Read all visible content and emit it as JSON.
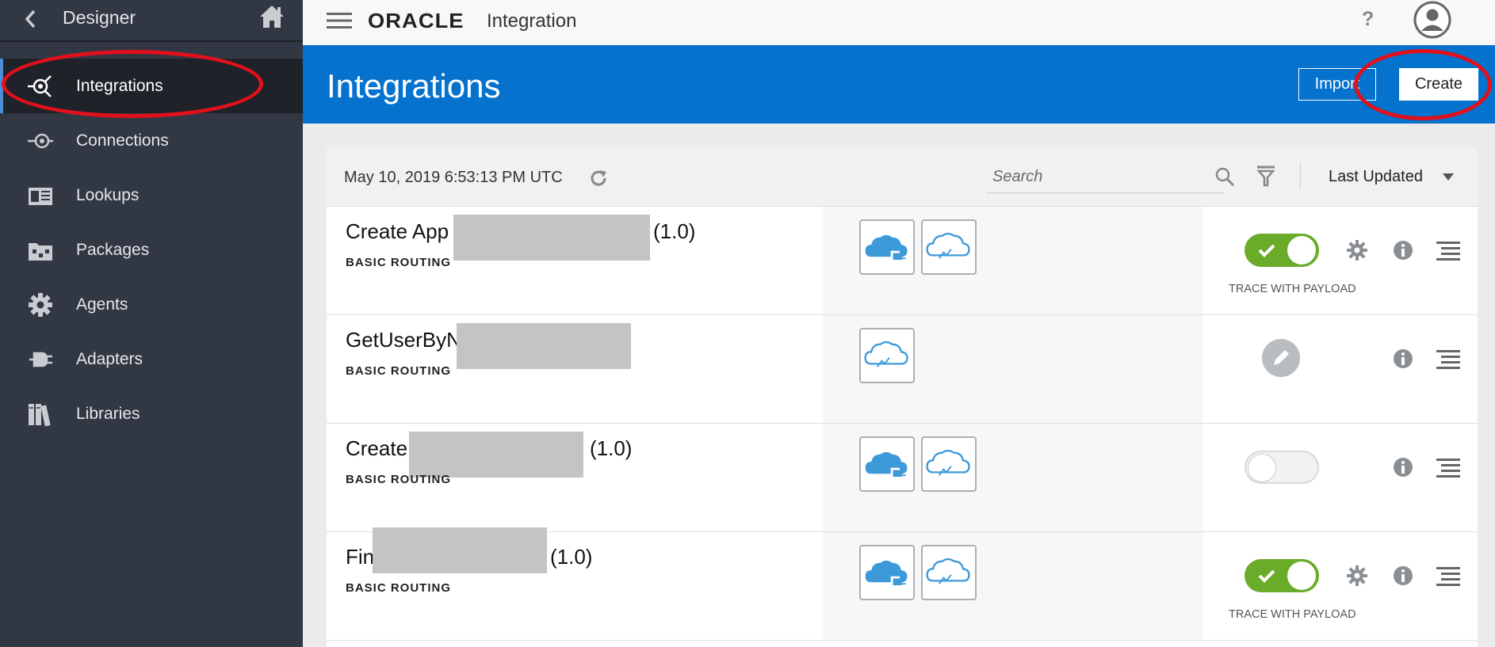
{
  "sidebar": {
    "title": "Designer",
    "items": [
      {
        "label": "Integrations",
        "icon": "integrations-icon"
      },
      {
        "label": "Connections",
        "icon": "connections-icon"
      },
      {
        "label": "Lookups",
        "icon": "lookups-icon"
      },
      {
        "label": "Packages",
        "icon": "packages-icon"
      },
      {
        "label": "Agents",
        "icon": "agents-icon"
      },
      {
        "label": "Adapters",
        "icon": "adapters-icon"
      },
      {
        "label": "Libraries",
        "icon": "libraries-icon"
      }
    ]
  },
  "topbar": {
    "logo": "ORACLE",
    "product": "Integration",
    "help": "?"
  },
  "header": {
    "title": "Integrations",
    "import_label": "Import",
    "create_label": "Create"
  },
  "filterbar": {
    "timestamp": "May 10, 2019 6:53:13 PM UTC",
    "search_placeholder": "Search",
    "sort_label": "Last Updated"
  },
  "rows": [
    {
      "name_prefix": "Create App",
      "version": "(1.0)",
      "pattern": "BASIC ROUTING",
      "status": "active",
      "trace": "TRACE WITH PAYLOAD"
    },
    {
      "name_prefix": "GetUserByN",
      "version": "",
      "pattern": "BASIC ROUTING",
      "status": "draft",
      "trace": ""
    },
    {
      "name_prefix": "Create",
      "version": "(1.0)",
      "pattern": "BASIC ROUTING",
      "status": "inactive",
      "trace": ""
    },
    {
      "name_prefix": "Fin",
      "version": "(1.0)",
      "pattern": "BASIC ROUTING",
      "status": "active",
      "trace": "TRACE WITH PAYLOAD"
    }
  ],
  "colors": {
    "sidebar_bg": "#323843",
    "header_blue": "#0572ce",
    "toggle_on": "#6bab2a",
    "annotation_red": "#e3101c",
    "cloud_blue": "#3d9ad9"
  }
}
